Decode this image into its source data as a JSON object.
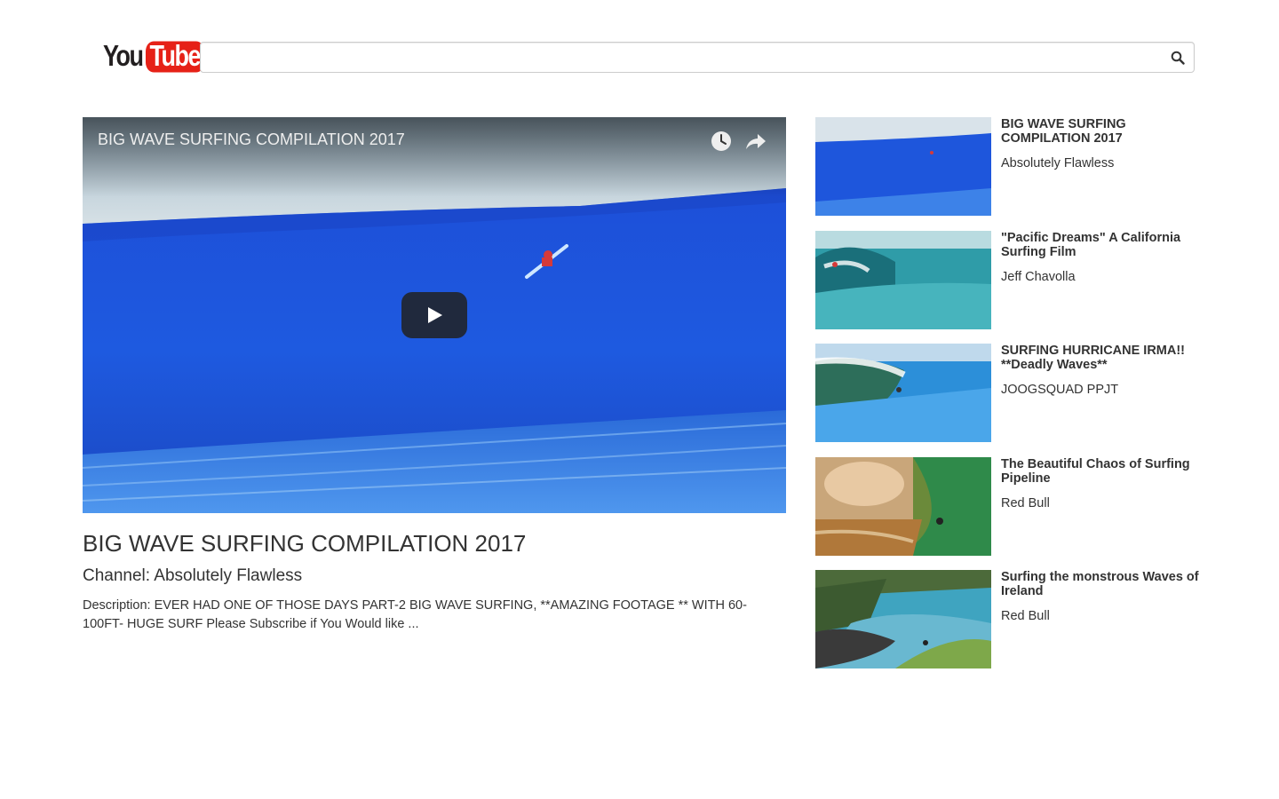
{
  "header": {
    "logo_you": "You",
    "logo_tube": "Tube",
    "search": {
      "value": "",
      "placeholder": ""
    }
  },
  "player": {
    "title": "BIG WAVE SURFING COMPILATION 2017",
    "icons": [
      "clock-icon",
      "share-icon",
      "play-icon"
    ]
  },
  "video": {
    "title": "BIG WAVE SURFING COMPILATION 2017",
    "channel": "Channel: Absolutely Flawless",
    "description": "Description: EVER HAD ONE OF THOSE DAYS PART-2 BIG WAVE SURFING, **AMAZING FOOTAGE ** WITH 60-100FT- HUGE SURF Please Subscribe if You Would like ..."
  },
  "related": [
    {
      "title": "BIG WAVE SURFING COMPILATION 2017",
      "channel": "Absolutely Flawless"
    },
    {
      "title": "\"Pacific Dreams\" A California Surfing Film",
      "channel": "Jeff Chavolla"
    },
    {
      "title": "SURFING HURRICANE IRMA!! **Deadly Waves**",
      "channel": "JOOGSQUAD PPJT"
    },
    {
      "title": "The Beautiful Chaos of Surfing Pipeline",
      "channel": "Red Bull"
    },
    {
      "title": "Surfing the monstrous Waves of Ireland",
      "channel": "Red Bull"
    }
  ],
  "colors": {
    "brand_red": "#e62117",
    "wave_blue": "#1f5ad6",
    "text": "#333333"
  }
}
